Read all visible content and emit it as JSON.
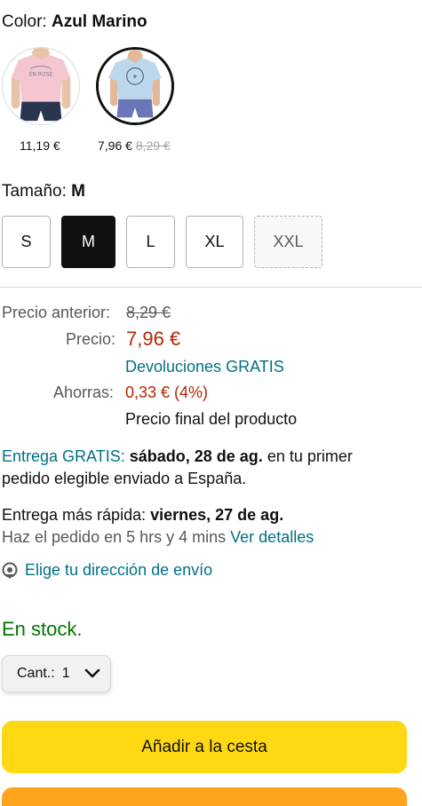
{
  "color": {
    "label": "Color:",
    "value": "Azul Marino"
  },
  "swatches": [
    {
      "name": "rosa",
      "price": "11,19 €"
    },
    {
      "name": "azul",
      "price": "7,96 €",
      "old_price": "8,29 €"
    }
  ],
  "size": {
    "label": "Tamaño:",
    "value": "M",
    "options": [
      "S",
      "M",
      "L",
      "XL",
      "XXL"
    ]
  },
  "pricing": {
    "prev_label": "Precio anterior:",
    "prev_value": "8,29 €",
    "price_label": "Precio:",
    "price_value": "7,96 €",
    "returns": "Devoluciones GRATIS",
    "save_label": "Ahorras:",
    "save_value": "0,33 € (4%)",
    "final_note": "Precio final del producto"
  },
  "delivery": {
    "prefix": "Entrega GRATIS:",
    "date": "sábado, 28 de ag.",
    "suffix": "en tu primer pedido elegible enviado a España."
  },
  "fast_delivery": {
    "prefix": "Entrega más rápida:",
    "date": "viernes, 27 de ag.",
    "order_within": "Haz el pedido en 5 hrs y 4 mins",
    "details_link": "Ver detalles"
  },
  "address_link": "Elige tu dirección de envío",
  "stock": "En stock.",
  "quantity": {
    "label": "Cant.:",
    "value": "1"
  },
  "add_to_cart": "Añadir a la cesta",
  "colors": {
    "price_red": "#b12704",
    "link_teal": "#007185",
    "stock_green": "#007600",
    "cart_yellow": "#ffd814",
    "buy_orange": "#ffa41c"
  }
}
